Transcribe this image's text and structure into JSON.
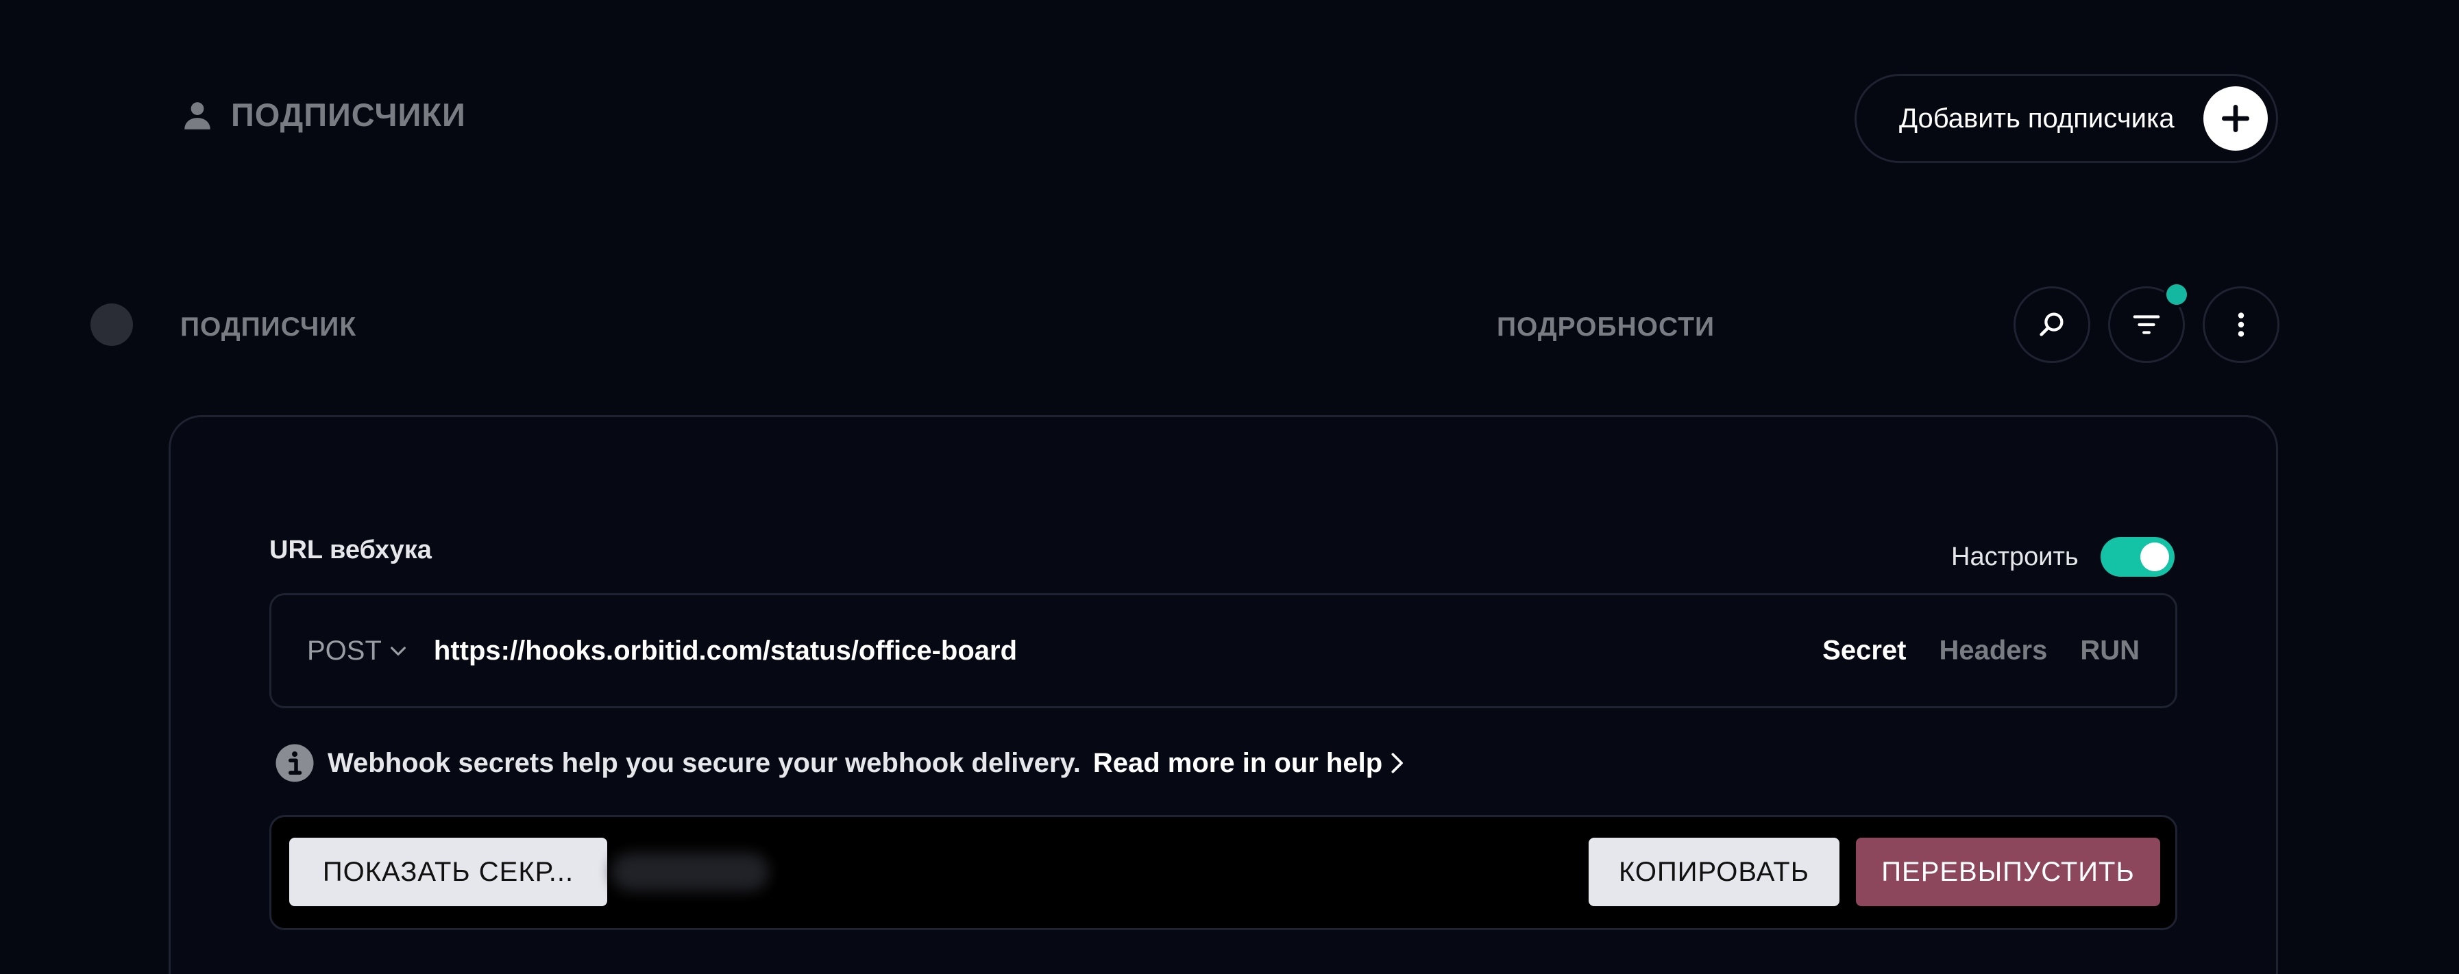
{
  "header": {
    "title": "ПОДПИСЧИКИ",
    "person_icon": "person-icon",
    "add_button_label": "Добавить подписчика",
    "add_icon": "plus-icon"
  },
  "columns": {
    "subscriber": "ПОДПИСЧИК",
    "details": "ПОДРОБНОСТИ"
  },
  "toolbar": {
    "icons": [
      "search-icon",
      "filter-icon",
      "more-vertical-icon"
    ],
    "filter_badge_color": "#14b8a0"
  },
  "webhook": {
    "label": "URL вебхука",
    "configure_label": "Настроить",
    "configure_enabled": true,
    "method": "POST",
    "url": "https://hooks.orbitid.com/status/office-board",
    "tabs": [
      {
        "label": "Secret",
        "active": true
      },
      {
        "label": "Headers",
        "active": false
      },
      {
        "label": "RUN",
        "active": false
      }
    ],
    "info_text": "Webhook secrets help you secure your webhook delivery.",
    "info_link": "Read more in our help",
    "show_secret_label": "ПОКАЗАТЬ СЕКР...",
    "copy_label": "КОПИРОВАТЬ",
    "reissue_label": "ПЕРЕВЫПУСТИТЬ"
  },
  "colors": {
    "background": "#050711",
    "accent": "#14c2a5",
    "danger": "#8c475d"
  }
}
